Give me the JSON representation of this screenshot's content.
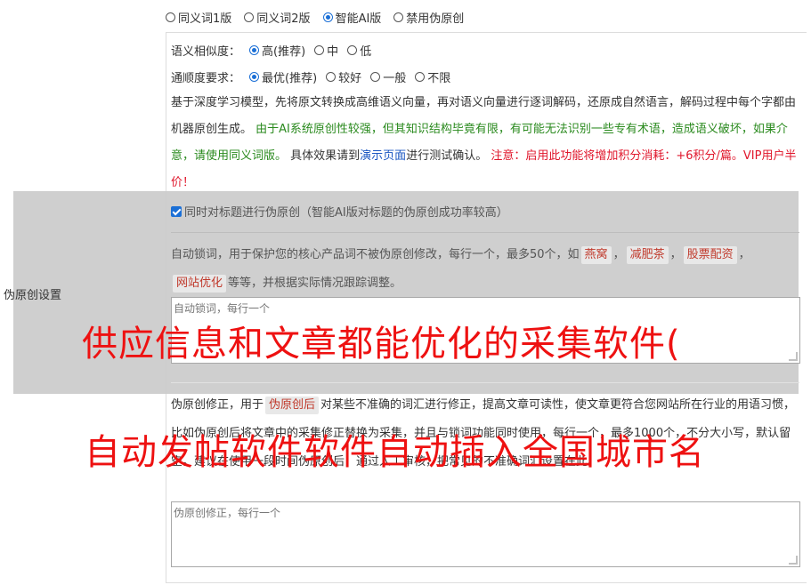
{
  "mode_options": [
    {
      "label": "同义词1版",
      "checked": false
    },
    {
      "label": "同义词2版",
      "checked": false
    },
    {
      "label": "智能AI版",
      "checked": true
    },
    {
      "label": "禁用伪原创",
      "checked": false
    }
  ],
  "similarity": {
    "label": "语义相似度：",
    "options": [
      {
        "label": "高(推荐)",
        "checked": true
      },
      {
        "label": "中",
        "checked": false
      },
      {
        "label": "低",
        "checked": false
      }
    ]
  },
  "fluency": {
    "label": "通顺度要求：",
    "options": [
      {
        "label": "最优(推荐)",
        "checked": true
      },
      {
        "label": "较好",
        "checked": false
      },
      {
        "label": "一般",
        "checked": false
      },
      {
        "label": "不限",
        "checked": false
      }
    ]
  },
  "description": {
    "part1": "基于深度学习模型，先将原文转换成高维语义向量，再对语义向量进行逐词解码，还原成自然语言，解码过程中每个字都由机器原创生成。",
    "part2_green": "由于AI系统原创性较强，但其知识结构毕竟有限，有可能无法识别一些专有术语，造成语义破坏，如果介意，请使用同义词版。",
    "part3": "具体效果请到",
    "link": "演示页面",
    "part4": "进行测试确认。",
    "part5_red": "注意：启用此功能将增加积分消耗：+6积分/篇。VIP用户半价！"
  },
  "side_label": "伪原创设置",
  "title_checkbox": "同时对标题进行伪原创（智能AI版对标题的伪原创成功率较高）",
  "lock_words": {
    "text1": "自动锁词，用于保护您的核心产品词不被伪原创修改，每行一个，最多50个，如",
    "tags": [
      "燕窝",
      "减肥茶",
      "股票配资",
      "网站优化"
    ],
    "sep": "，",
    "text2": "等等，并根据实际情况跟踪调整。",
    "placeholder": "自动锁词，每行一个"
  },
  "correction": {
    "text1": "伪原创修正，用于",
    "tag": "伪原创后",
    "text2": "对某些不准确的词汇进行修正，提高文章可读性，使文章更符合您网站所在行业的用语习惯，比如伪原创后将文章中的采集修正替换为采集，并且与锁词功能同时使用，每行一个，最多1000个，不分大小写，默认留空。建议在使用一段时间伪原创后，通过人工审核，把常见的不准确词汇设置在此。",
    "placeholder": "伪原创修正，每行一个"
  },
  "watermark": {
    "line1": "供应信息和文章都能优化的采集软件(",
    "line2": "自动发帖软件软件自动插入全国城市名"
  }
}
